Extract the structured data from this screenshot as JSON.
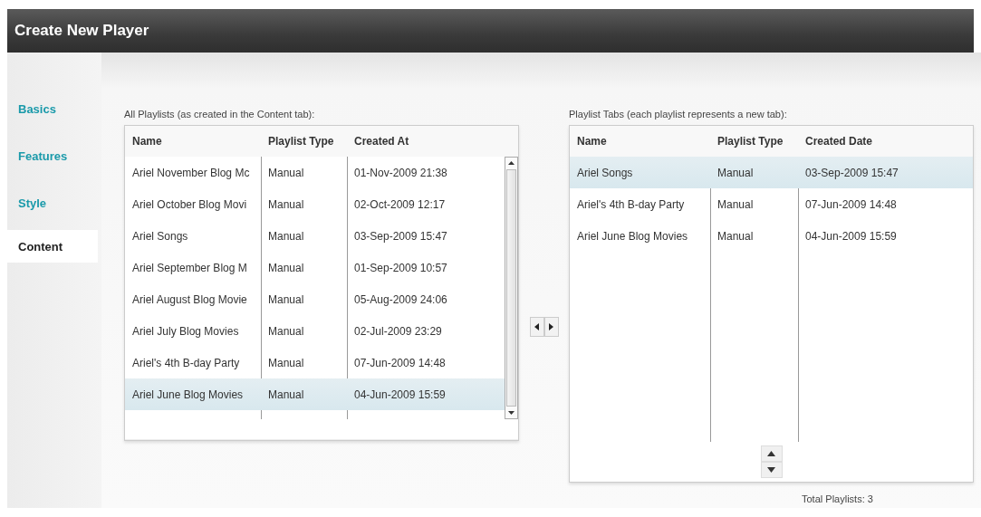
{
  "window": {
    "title": "Create New Player"
  },
  "tabs": [
    {
      "label": "Basics",
      "selected": false
    },
    {
      "label": "Features",
      "selected": false
    },
    {
      "label": "Style",
      "selected": false
    },
    {
      "label": "Content",
      "selected": true
    }
  ],
  "all_playlists": {
    "caption": "All Playlists (as created in the Content tab):",
    "columns": [
      "Name",
      "Playlist Type",
      "Created At"
    ],
    "rows": [
      {
        "cells": [
          "Ariel November Blog Mc",
          "Manual",
          "01-Nov-2009 21:38"
        ],
        "selected": false
      },
      {
        "cells": [
          "Ariel October Blog Movi",
          "Manual",
          "02-Oct-2009 12:17"
        ],
        "selected": false
      },
      {
        "cells": [
          "Ariel Songs",
          "Manual",
          "03-Sep-2009 15:47"
        ],
        "selected": false
      },
      {
        "cells": [
          "Ariel September Blog M",
          "Manual",
          "01-Sep-2009 10:57"
        ],
        "selected": false
      },
      {
        "cells": [
          "Ariel August Blog Movie",
          "Manual",
          "05-Aug-2009 24:06"
        ],
        "selected": false
      },
      {
        "cells": [
          "Ariel July Blog Movies",
          "Manual",
          "02-Jul-2009 23:29"
        ],
        "selected": false
      },
      {
        "cells": [
          "Ariel's 4th B-day Party",
          "Manual",
          "07-Jun-2009 14:48"
        ],
        "selected": false
      },
      {
        "cells": [
          "Ariel June Blog Movies",
          "Manual",
          "04-Jun-2009 15:59"
        ],
        "selected": true
      }
    ]
  },
  "playlist_tabs": {
    "caption": "Playlist Tabs (each playlist represents a new tab):",
    "columns": [
      "Name",
      "Playlist Type",
      "Created Date"
    ],
    "rows": [
      {
        "cells": [
          "Ariel Songs",
          "Manual",
          "03-Sep-2009 15:47"
        ],
        "selected": true
      },
      {
        "cells": [
          "Ariel's 4th B-day Party",
          "Manual",
          "07-Jun-2009 14:48"
        ],
        "selected": false
      },
      {
        "cells": [
          "Ariel June Blog Movies",
          "Manual",
          "04-Jun-2009 15:59"
        ],
        "selected": false
      }
    ],
    "total": "Total Playlists: 3"
  }
}
